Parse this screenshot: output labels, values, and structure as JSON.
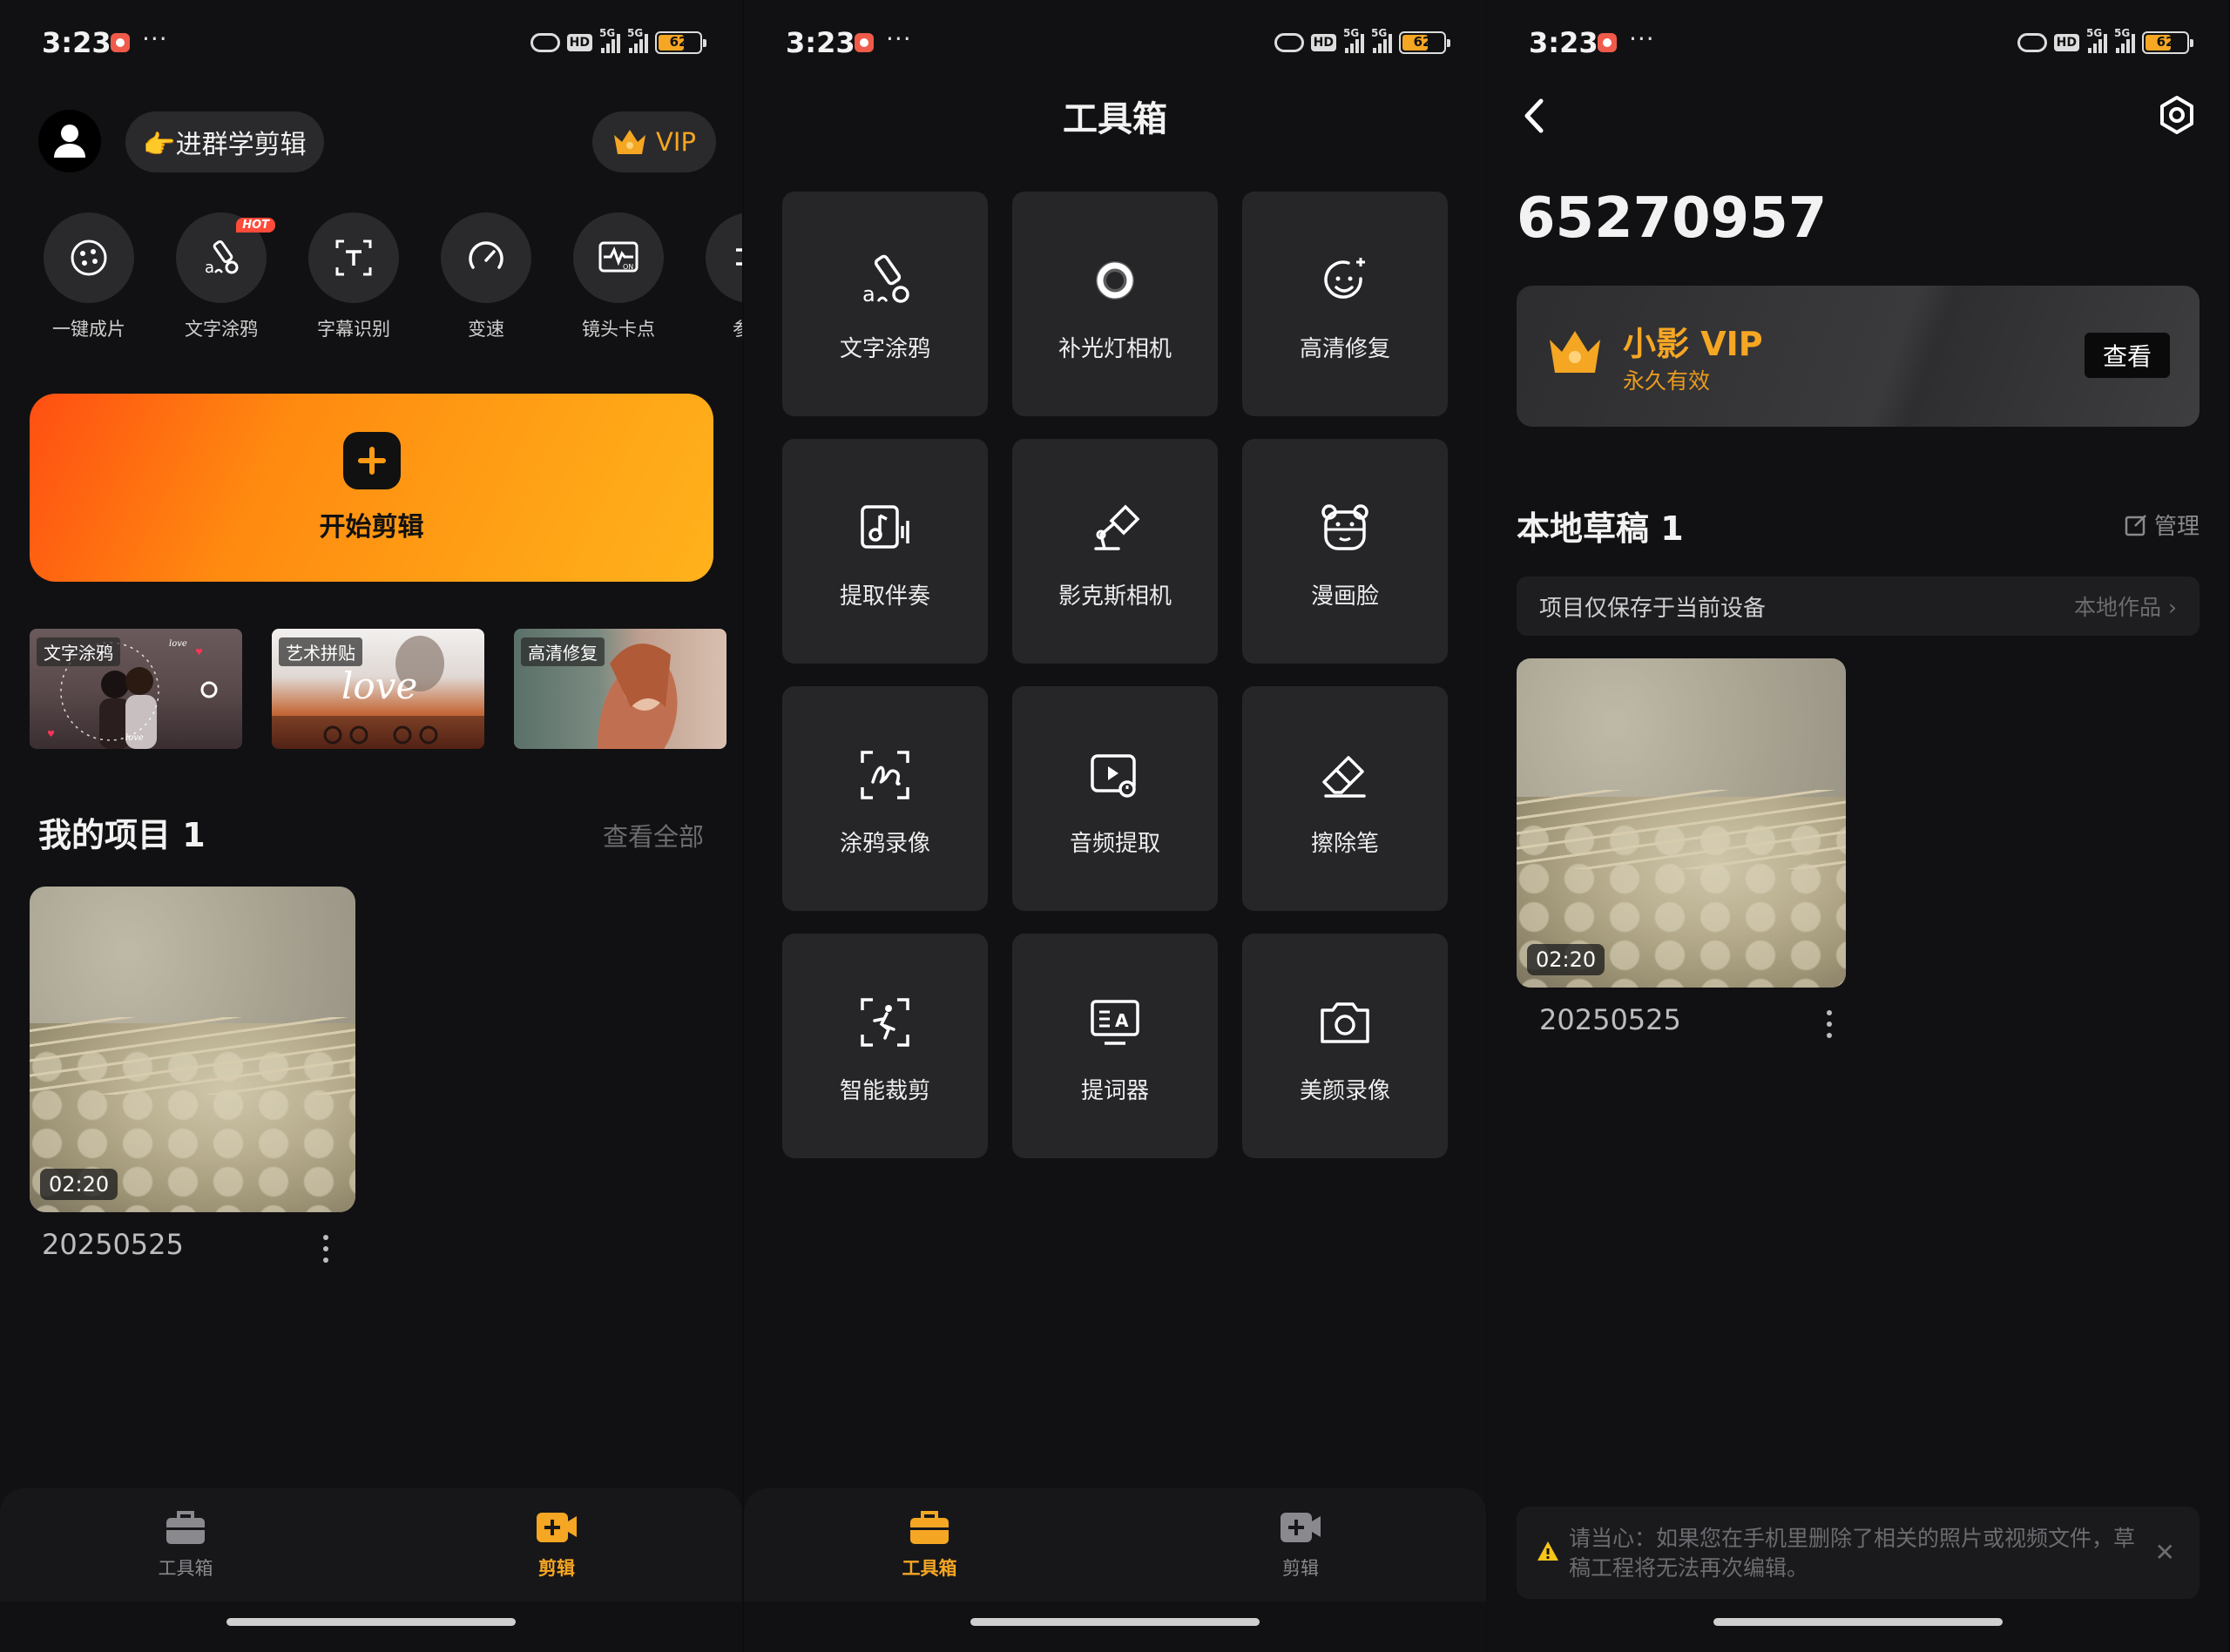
{
  "status": {
    "time": "3:23",
    "dots": "···",
    "hd": "HD",
    "net1": "5G",
    "net2": "5G",
    "battery": "62"
  },
  "screen1": {
    "group_button": "👉进群学剪辑",
    "vip_pill": "VIP",
    "tools": [
      {
        "label": "一键成片",
        "icon": "film-reel-icon"
      },
      {
        "label": "文字涂鸦",
        "icon": "text-doodle-icon",
        "badge": "HOT"
      },
      {
        "label": "字幕识别",
        "icon": "subtitle-recognize-icon"
      },
      {
        "label": "变速",
        "icon": "speedometer-icon"
      },
      {
        "label": "镜头卡点",
        "icon": "beat-sync-icon"
      },
      {
        "label": "参数",
        "icon": "params-icon"
      }
    ],
    "start_label": "开始剪辑",
    "thumbs": [
      {
        "tag": "文字涂鸦",
        "art": "love"
      },
      {
        "tag": "艺术拼贴",
        "art": "love"
      },
      {
        "tag": "高清修复"
      }
    ],
    "section_title": "我的项目 1",
    "section_link": "查看全部",
    "project": {
      "duration": "02:20",
      "name": "20250525"
    }
  },
  "screen2": {
    "title": "工具箱",
    "tools": [
      {
        "label": "文字涂鸦",
        "icon": "text-doodle-icon"
      },
      {
        "label": "补光灯相机",
        "icon": "fill-light-icon"
      },
      {
        "label": "高清修复",
        "icon": "hd-restore-icon"
      },
      {
        "label": "提取伴奏",
        "icon": "extract-accompaniment-icon"
      },
      {
        "label": "影克斯相机",
        "icon": "desk-lamp-icon"
      },
      {
        "label": "漫画脸",
        "icon": "comic-face-icon"
      },
      {
        "label": "涂鸦录像",
        "icon": "doodle-record-icon"
      },
      {
        "label": "音频提取",
        "icon": "audio-extract-icon"
      },
      {
        "label": "擦除笔",
        "icon": "eraser-icon"
      },
      {
        "label": "智能裁剪",
        "icon": "smart-crop-icon"
      },
      {
        "label": "提词器",
        "icon": "teleprompter-icon"
      },
      {
        "label": "美颜录像",
        "icon": "camera-icon"
      }
    ]
  },
  "screen3": {
    "user_id": "65270957",
    "vip_name": "小影 VIP",
    "vip_sub": "永久有效",
    "vip_button": "查看",
    "draft_title": "本地草稿 1",
    "manage": "管理",
    "notice_left": "项目仅保存于当前设备",
    "notice_right": "本地作品",
    "project": {
      "duration": "02:20",
      "name": "20250525"
    },
    "warning": "请当心：如果您在手机里删除了相关的照片或视频文件，草稿工程将无法再次编辑。"
  },
  "nav": {
    "toolbox": "工具箱",
    "edit": "剪辑"
  },
  "colors": {
    "accent": "#f5a623",
    "bg": "#111113",
    "card": "#262629",
    "orange_start": "#ff4f12",
    "orange_end": "#ffb21c"
  }
}
